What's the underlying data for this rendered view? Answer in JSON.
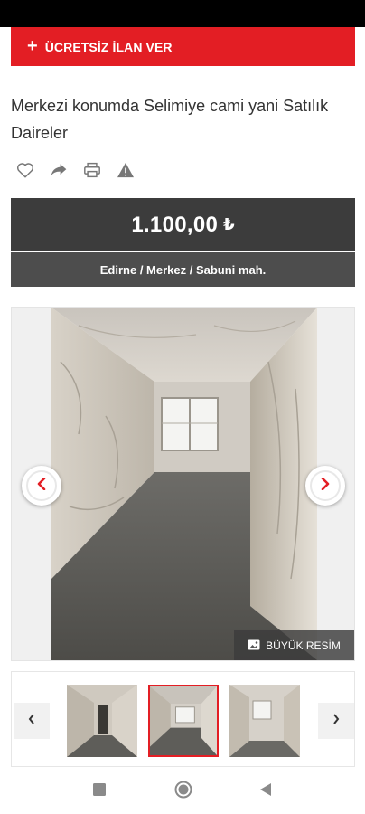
{
  "header": {
    "cta_label": "ÜCRETSİZ İLAN VER",
    "cta_icon": "plus-icon"
  },
  "listing": {
    "title": "Merkezi konumda Selimiye cami yani Satılık Daireler",
    "price": "1.100,00",
    "currency": "₺",
    "location": "Edirne / Merkez / Sabuni mah."
  },
  "actions": [
    {
      "icon": "heart-icon"
    },
    {
      "icon": "share-icon"
    },
    {
      "icon": "print-icon"
    },
    {
      "icon": "warning-icon"
    }
  ],
  "gallery": {
    "big_photo_label": "BÜYÜK RESİM",
    "selected_thumb_index": 1,
    "thumb_count_visible": 3
  },
  "colors": {
    "brand_red": "#e31e24",
    "price_bg": "#3c3c3c",
    "location_bg": "#4d4d4d",
    "icon_gray": "#777777"
  }
}
